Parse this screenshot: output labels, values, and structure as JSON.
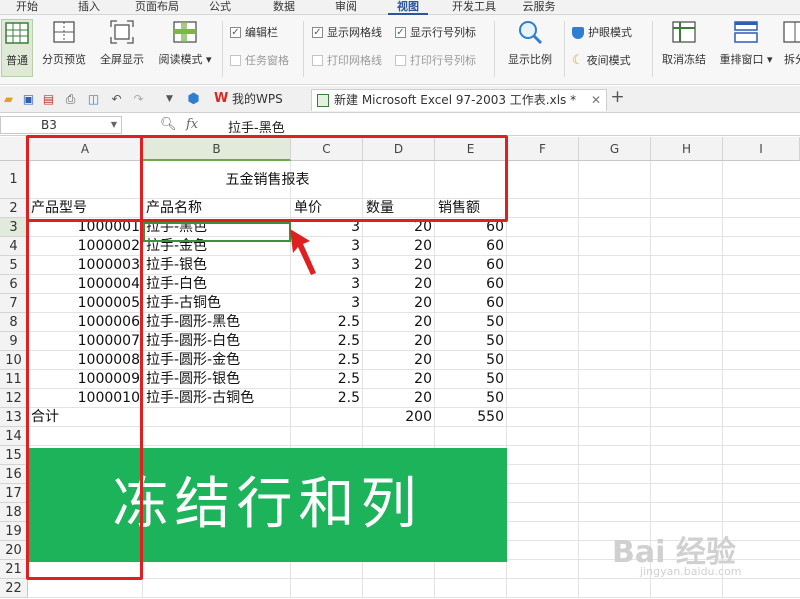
{
  "menu": {
    "items": [
      "开始",
      "插入",
      "页面布局",
      "公式",
      "数据",
      "审阅",
      "视图",
      "开发工具",
      "云服务"
    ],
    "active": "视图"
  },
  "ribbon": {
    "buttons": [
      {
        "label": "普通",
        "icon": "normal-view-icon"
      },
      {
        "label": "分页预览",
        "icon": "page-break-icon"
      },
      {
        "label": "全屏显示",
        "icon": "fullscreen-icon"
      },
      {
        "label": "阅读模式 ▾",
        "icon": "reading-mode-icon"
      }
    ],
    "checks_col1": [
      {
        "label": "编辑栏",
        "checked": true
      },
      {
        "label": "任务窗格",
        "checked": false
      }
    ],
    "checks_col2": [
      {
        "label": "显示网格线",
        "checked": true
      },
      {
        "label": "打印网格线",
        "checked": false
      }
    ],
    "checks_col3": [
      {
        "label": "显示行号列标",
        "checked": true
      },
      {
        "label": "打印行号列标",
        "checked": false
      }
    ],
    "zoom_label": "显示比例",
    "eye_protect": "护眼模式",
    "night_mode": "夜间模式",
    "unfreeze": "取消冻结",
    "rearrange": "重排窗口 ▾",
    "split": "拆分"
  },
  "tabs": {
    "wps": "我的WPS",
    "doc": "新建 Microsoft Excel 97-2003 工作表.xls *",
    "add": "+"
  },
  "formula": {
    "cell_ref": "B3",
    "fx": "fx",
    "content": "拉手-黑色"
  },
  "sheet": {
    "columns": [
      "A",
      "B",
      "C",
      "D",
      "E",
      "F",
      "G",
      "H",
      "I"
    ],
    "rows": [
      "1",
      "2",
      "3",
      "4",
      "5",
      "6",
      "7",
      "8",
      "9",
      "10",
      "11",
      "12",
      "13",
      "14",
      "15",
      "16",
      "17",
      "18",
      "19",
      "20",
      "21",
      "22"
    ],
    "title": "五金销售报表",
    "headers": [
      "产品型号",
      "产品名称",
      "单价",
      "数量",
      "销售额"
    ],
    "data": [
      [
        "1000001",
        "拉手-黑色",
        "3",
        "20",
        "60"
      ],
      [
        "1000002",
        "拉手-金色",
        "3",
        "20",
        "60"
      ],
      [
        "1000003",
        "拉手-银色",
        "3",
        "20",
        "60"
      ],
      [
        "1000004",
        "拉手-白色",
        "3",
        "20",
        "60"
      ],
      [
        "1000005",
        "拉手-古铜色",
        "3",
        "20",
        "60"
      ],
      [
        "1000006",
        "拉手-圆形-黑色",
        "2.5",
        "20",
        "50"
      ],
      [
        "1000007",
        "拉手-圆形-白色",
        "2.5",
        "20",
        "50"
      ],
      [
        "1000008",
        "拉手-圆形-金色",
        "2.5",
        "20",
        "50"
      ],
      [
        "1000009",
        "拉手-圆形-银色",
        "2.5",
        "20",
        "50"
      ],
      [
        "1000010",
        "拉手-圆形-古铜色",
        "2.5",
        "20",
        "50"
      ]
    ],
    "total_label": "合计",
    "total_qty": "200",
    "total_sales": "550"
  },
  "banner": {
    "text": "冻结行和列",
    "color": "#1db35a"
  },
  "watermark": {
    "logo": "Bai 经验",
    "url": "jingyan.baidu.com"
  },
  "accent": "#e02020"
}
